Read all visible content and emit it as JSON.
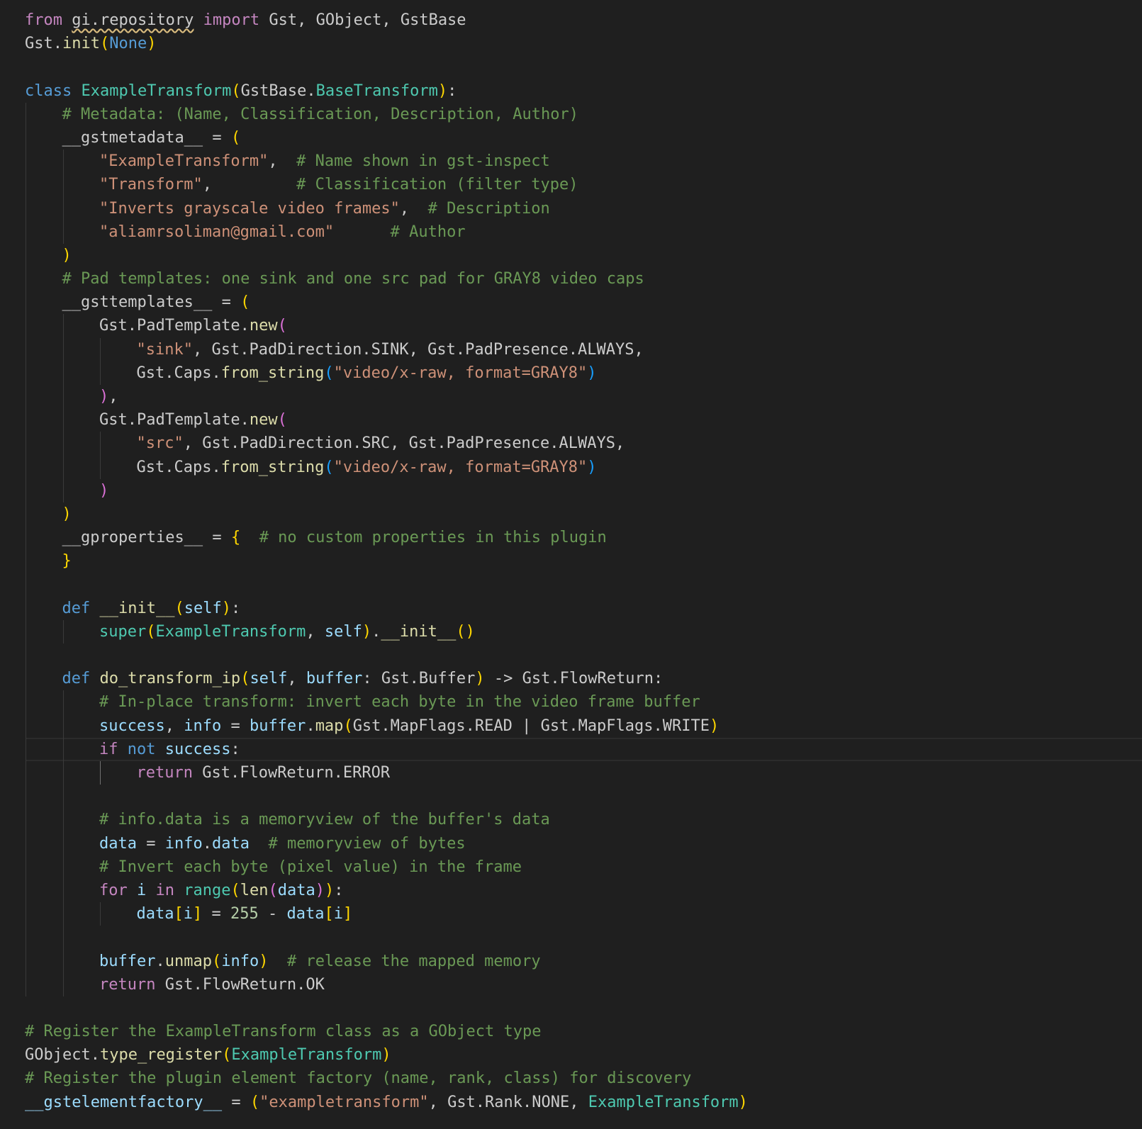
{
  "theme": {
    "background": "#1f1f1f",
    "guide": "#3a3a3a",
    "guide_active": "#707070"
  },
  "colors": {
    "k": "#c586c0",
    "kw": "#569cd6",
    "c": "#6a9955",
    "s": "#ce9178",
    "cls": "#4ec9b0",
    "fn": "#dcdcaa",
    "v": "#9cdcfe",
    "n": "#b5cea8",
    "p": "#cccccc",
    "b1": "#ffd700",
    "b2": "#da70d6",
    "b3": "#179fff"
  },
  "editor": {
    "lines": [
      {
        "indent": 0,
        "tokens": [
          [
            "from",
            "k"
          ],
          [
            " ",
            "p"
          ],
          [
            "gi.repository",
            "p",
            "squiggle"
          ],
          [
            " ",
            "p"
          ],
          [
            "import",
            "k"
          ],
          [
            " Gst, GObject, GstBase",
            "p"
          ]
        ]
      },
      {
        "indent": 0,
        "tokens": [
          [
            "Gst.",
            "p"
          ],
          [
            "init",
            "fn"
          ],
          [
            "(",
            "b1"
          ],
          [
            "None",
            "kw"
          ],
          [
            ")",
            "b1"
          ]
        ]
      },
      {
        "indent": 0,
        "tokens": []
      },
      {
        "indent": 0,
        "tokens": [
          [
            "class",
            "kw"
          ],
          [
            " ",
            "p"
          ],
          [
            "ExampleTransform",
            "cls"
          ],
          [
            "(",
            "b1"
          ],
          [
            "GstBase.",
            "p"
          ],
          [
            "BaseTransform",
            "cls"
          ],
          [
            ")",
            "b1"
          ],
          [
            ":",
            "p"
          ]
        ]
      },
      {
        "indent": 1,
        "tokens": [
          [
            "# Metadata: (Name, Classification, Description, Author)",
            "c"
          ]
        ]
      },
      {
        "indent": 1,
        "tokens": [
          [
            "__gstmetadata__",
            "p"
          ],
          [
            " = ",
            "p"
          ],
          [
            "(",
            "b1"
          ]
        ]
      },
      {
        "indent": 2,
        "tokens": [
          [
            "\"ExampleTransform\"",
            "s"
          ],
          [
            ",  ",
            "p"
          ],
          [
            "# Name shown in gst-inspect",
            "c"
          ]
        ]
      },
      {
        "indent": 2,
        "tokens": [
          [
            "\"Transform\"",
            "s"
          ],
          [
            ",         ",
            "p"
          ],
          [
            "# Classification (filter type)",
            "c"
          ]
        ]
      },
      {
        "indent": 2,
        "tokens": [
          [
            "\"Inverts grayscale video frames\"",
            "s"
          ],
          [
            ",  ",
            "p"
          ],
          [
            "# Description",
            "c"
          ]
        ]
      },
      {
        "indent": 2,
        "tokens": [
          [
            "\"aliamrsoliman@gmail.com\"",
            "s"
          ],
          [
            "      ",
            "p"
          ],
          [
            "# Author",
            "c"
          ]
        ]
      },
      {
        "indent": 1,
        "tokens": [
          [
            ")",
            "b1"
          ]
        ]
      },
      {
        "indent": 1,
        "tokens": [
          [
            "# Pad templates: one sink and one src pad for GRAY8 video caps",
            "c"
          ]
        ]
      },
      {
        "indent": 1,
        "tokens": [
          [
            "__gsttemplates__",
            "p"
          ],
          [
            " = ",
            "p"
          ],
          [
            "(",
            "b1"
          ]
        ]
      },
      {
        "indent": 2,
        "tokens": [
          [
            "Gst.PadTemplate.",
            "p"
          ],
          [
            "new",
            "fn"
          ],
          [
            "(",
            "b2"
          ]
        ]
      },
      {
        "indent": 3,
        "tokens": [
          [
            "\"sink\"",
            "s"
          ],
          [
            ", Gst.PadDirection.SINK, Gst.PadPresence.ALWAYS,",
            "p"
          ]
        ]
      },
      {
        "indent": 3,
        "tokens": [
          [
            "Gst.Caps.",
            "p"
          ],
          [
            "from_string",
            "fn"
          ],
          [
            "(",
            "b3"
          ],
          [
            "\"video/x-raw, format=GRAY8\"",
            "s"
          ],
          [
            ")",
            "b3"
          ]
        ]
      },
      {
        "indent": 2,
        "tokens": [
          [
            ")",
            "b2"
          ],
          [
            ",",
            "p"
          ]
        ]
      },
      {
        "indent": 2,
        "tokens": [
          [
            "Gst.PadTemplate.",
            "p"
          ],
          [
            "new",
            "fn"
          ],
          [
            "(",
            "b2"
          ]
        ]
      },
      {
        "indent": 3,
        "tokens": [
          [
            "\"src\"",
            "s"
          ],
          [
            ", Gst.PadDirection.SRC, Gst.PadPresence.ALWAYS,",
            "p"
          ]
        ]
      },
      {
        "indent": 3,
        "tokens": [
          [
            "Gst.Caps.",
            "p"
          ],
          [
            "from_string",
            "fn"
          ],
          [
            "(",
            "b3"
          ],
          [
            "\"video/x-raw, format=GRAY8\"",
            "s"
          ],
          [
            ")",
            "b3"
          ]
        ]
      },
      {
        "indent": 2,
        "tokens": [
          [
            ")",
            "b2"
          ]
        ]
      },
      {
        "indent": 1,
        "tokens": [
          [
            ")",
            "b1"
          ]
        ]
      },
      {
        "indent": 1,
        "tokens": [
          [
            "__gproperties__",
            "p"
          ],
          [
            " = ",
            "p"
          ],
          [
            "{",
            "b1"
          ],
          [
            "  ",
            "p"
          ],
          [
            "# no custom properties in this plugin",
            "c"
          ]
        ]
      },
      {
        "indent": 1,
        "tokens": [
          [
            "}",
            "b1"
          ]
        ]
      },
      {
        "indent": 1,
        "tokens": []
      },
      {
        "indent": 1,
        "tokens": [
          [
            "def",
            "kw"
          ],
          [
            " ",
            "p"
          ],
          [
            "__init__",
            "fn"
          ],
          [
            "(",
            "b1"
          ],
          [
            "self",
            "v"
          ],
          [
            ")",
            "b1"
          ],
          [
            ":",
            "p"
          ]
        ]
      },
      {
        "indent": 2,
        "tokens": [
          [
            "super",
            "cls"
          ],
          [
            "(",
            "b1"
          ],
          [
            "ExampleTransform",
            "cls"
          ],
          [
            ", ",
            "p"
          ],
          [
            "self",
            "v"
          ],
          [
            ")",
            "b1"
          ],
          [
            ".",
            "p"
          ],
          [
            "__init__",
            "fn"
          ],
          [
            "(",
            "b1"
          ],
          [
            ")",
            "b1"
          ]
        ]
      },
      {
        "indent": 1,
        "tokens": []
      },
      {
        "indent": 1,
        "tokens": [
          [
            "def",
            "kw"
          ],
          [
            " ",
            "p"
          ],
          [
            "do_transform_ip",
            "fn"
          ],
          [
            "(",
            "b1"
          ],
          [
            "self",
            "v"
          ],
          [
            ", ",
            "p"
          ],
          [
            "buffer",
            "v"
          ],
          [
            ": Gst.Buffer",
            "p"
          ],
          [
            ")",
            "b1"
          ],
          [
            " -> Gst.FlowReturn:",
            "p"
          ]
        ]
      },
      {
        "indent": 2,
        "tokens": [
          [
            "# In-place transform: invert each byte in the video frame buffer",
            "c"
          ]
        ]
      },
      {
        "indent": 2,
        "tokens": [
          [
            "success",
            "v"
          ],
          [
            ", ",
            "p"
          ],
          [
            "info",
            "v"
          ],
          [
            " = ",
            "p"
          ],
          [
            "buffer",
            "v"
          ],
          [
            ".",
            "p"
          ],
          [
            "map",
            "fn"
          ],
          [
            "(",
            "b1"
          ],
          [
            "Gst.MapFlags.READ | Gst.MapFlags.WRITE",
            "p"
          ],
          [
            ")",
            "b1"
          ]
        ]
      },
      {
        "indent": 2,
        "cursor": true,
        "tokens": [
          [
            "if",
            "k"
          ],
          [
            " ",
            "p"
          ],
          [
            "not",
            "kw"
          ],
          [
            " ",
            "p"
          ],
          [
            "success",
            "v"
          ],
          [
            ":",
            "p"
          ]
        ]
      },
      {
        "indent": 3,
        "tokens": [
          [
            "return",
            "k"
          ],
          [
            " Gst.FlowReturn.ERROR",
            "p"
          ]
        ]
      },
      {
        "indent": 2,
        "tokens": []
      },
      {
        "indent": 2,
        "tokens": [
          [
            "# info.data is a memoryview of the buffer's data",
            "c"
          ]
        ]
      },
      {
        "indent": 2,
        "tokens": [
          [
            "data",
            "v"
          ],
          [
            " = ",
            "p"
          ],
          [
            "info",
            "v"
          ],
          [
            ".",
            "p"
          ],
          [
            "data",
            "v"
          ],
          [
            "  ",
            "p"
          ],
          [
            "# memoryview of bytes",
            "c"
          ]
        ]
      },
      {
        "indent": 2,
        "tokens": [
          [
            "# Invert each byte (pixel value) in the frame",
            "c"
          ]
        ]
      },
      {
        "indent": 2,
        "tokens": [
          [
            "for",
            "k"
          ],
          [
            " ",
            "p"
          ],
          [
            "i",
            "v"
          ],
          [
            " ",
            "p"
          ],
          [
            "in",
            "k"
          ],
          [
            " ",
            "p"
          ],
          [
            "range",
            "cls"
          ],
          [
            "(",
            "b1"
          ],
          [
            "len",
            "fn"
          ],
          [
            "(",
            "b2"
          ],
          [
            "data",
            "v"
          ],
          [
            ")",
            "b2"
          ],
          [
            ")",
            "b1"
          ],
          [
            ":",
            "p"
          ]
        ]
      },
      {
        "indent": 3,
        "tokens": [
          [
            "data",
            "v"
          ],
          [
            "[",
            "b1"
          ],
          [
            "i",
            "v"
          ],
          [
            "]",
            "b1"
          ],
          [
            " = ",
            "p"
          ],
          [
            "255",
            "n"
          ],
          [
            " - ",
            "p"
          ],
          [
            "data",
            "v"
          ],
          [
            "[",
            "b1"
          ],
          [
            "i",
            "v"
          ],
          [
            "]",
            "b1"
          ]
        ]
      },
      {
        "indent": 2,
        "tokens": []
      },
      {
        "indent": 2,
        "tokens": [
          [
            "buffer",
            "v"
          ],
          [
            ".",
            "p"
          ],
          [
            "unmap",
            "fn"
          ],
          [
            "(",
            "b1"
          ],
          [
            "info",
            "v"
          ],
          [
            ")",
            "b1"
          ],
          [
            "  ",
            "p"
          ],
          [
            "# release the mapped memory",
            "c"
          ]
        ]
      },
      {
        "indent": 2,
        "tokens": [
          [
            "return",
            "k"
          ],
          [
            " Gst.FlowReturn.OK",
            "p"
          ]
        ]
      },
      {
        "indent": 0,
        "tokens": []
      },
      {
        "indent": 0,
        "tokens": [
          [
            "# Register the ExampleTransform class as a GObject type",
            "c"
          ]
        ]
      },
      {
        "indent": 0,
        "tokens": [
          [
            "GObject.",
            "p"
          ],
          [
            "type_register",
            "fn"
          ],
          [
            "(",
            "b1"
          ],
          [
            "ExampleTransform",
            "cls"
          ],
          [
            ")",
            "b1"
          ]
        ]
      },
      {
        "indent": 0,
        "tokens": [
          [
            "# Register the plugin element factory (name, rank, class) for discovery",
            "c"
          ]
        ]
      },
      {
        "indent": 0,
        "tokens": [
          [
            "__gstelementfactory__",
            "v"
          ],
          [
            " = ",
            "p"
          ],
          [
            "(",
            "b1"
          ],
          [
            "\"exampletransform\"",
            "s"
          ],
          [
            ", Gst.Rank.NONE, ",
            "p"
          ],
          [
            "ExampleTransform",
            "cls"
          ],
          [
            ")",
            "b1"
          ]
        ]
      }
    ]
  }
}
